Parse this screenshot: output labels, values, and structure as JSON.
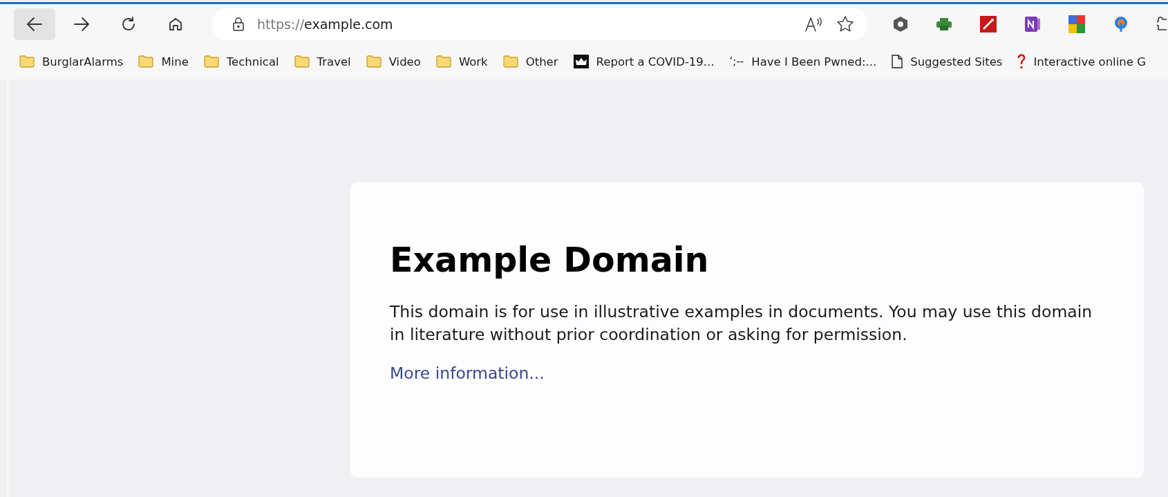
{
  "address_bar": {
    "scheme": "https://",
    "host": "example.com"
  },
  "nav_buttons": [
    {
      "kind": "back",
      "selected": true
    },
    {
      "kind": "forward",
      "selected": false
    },
    {
      "kind": "reload",
      "selected": false
    },
    {
      "kind": "home",
      "selected": false
    }
  ],
  "bookmarks": [
    {
      "kind": "folder",
      "label": "BurglarAlarms"
    },
    {
      "kind": "folder",
      "label": "Mine"
    },
    {
      "kind": "folder",
      "label": "Technical"
    },
    {
      "kind": "folder",
      "label": "Travel"
    },
    {
      "kind": "folder",
      "label": "Video"
    },
    {
      "kind": "folder",
      "label": "Work"
    },
    {
      "kind": "folder",
      "label": "Other"
    },
    {
      "kind": "crown",
      "label": "Report a COVID-19..."
    },
    {
      "kind": "glyph",
      "glyph": "‘;--",
      "label": "Have I Been Pwned:..."
    },
    {
      "kind": "page",
      "label": "Suggested Sites"
    },
    {
      "kind": "question",
      "label": "Interactive online G"
    }
  ],
  "page": {
    "heading": "Example Domain",
    "paragraph": "This domain is for use in illustrative examples in documents. You may use this domain in literature without prior coordination or asking for permission.",
    "link": "More information..."
  }
}
